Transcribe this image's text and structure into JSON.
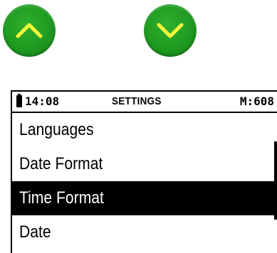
{
  "nav": {
    "up_icon": "chevron-up-icon",
    "down_icon": "chevron-down-icon",
    "button_color": "#1f9a20",
    "icon_color": "#f5f53a"
  },
  "status": {
    "battery_icon": "battery-icon",
    "time": "14:08",
    "title": "SETTINGS",
    "memory": "M:608"
  },
  "menu": {
    "items": [
      {
        "label": "Languages"
      },
      {
        "label": "Date Format"
      },
      {
        "label": "Time Format"
      },
      {
        "label": "Date"
      }
    ],
    "selected_index": 2
  }
}
